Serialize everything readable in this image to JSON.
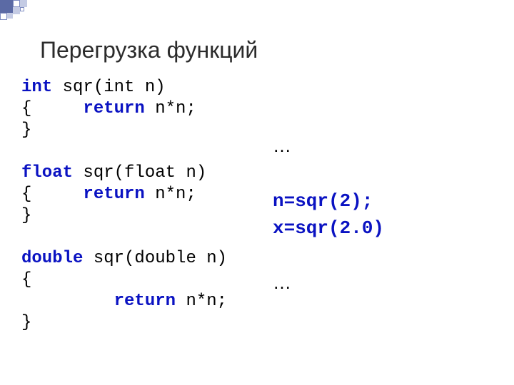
{
  "title": "Перегрузка функций",
  "code": {
    "kw_int": "int",
    "kw_float": "float",
    "kw_double": "double",
    "kw_return": "return",
    "sig_int_rest": " sqr(int n)",
    "sig_float_rest": " sqr(float n)",
    "sig_double_rest": " sqr(double n)",
    "brace_return_line": "{     ",
    "return_rest": " n*n;",
    "brace_close": "}",
    "brace_open": "{",
    "double_ret_indent": "         "
  },
  "usage": {
    "ellipsis": "…",
    "line1": "n=sqr(2);",
    "line2": "x=sqr(2.0)"
  }
}
